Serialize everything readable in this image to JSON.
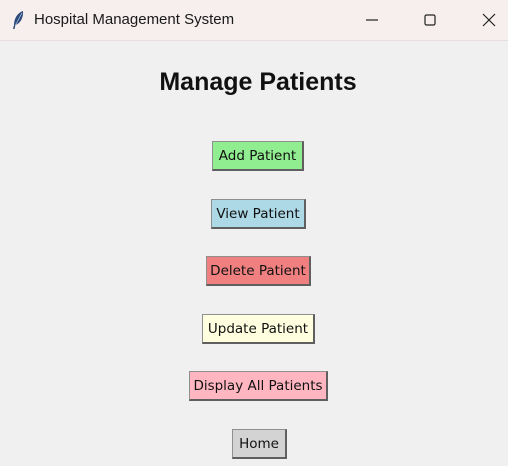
{
  "window": {
    "title": "Hospital Management System"
  },
  "page": {
    "heading": "Manage Patients"
  },
  "buttons": {
    "add": {
      "label": "Add Patient",
      "color": "#90ee90"
    },
    "view": {
      "label": "View Patient",
      "color": "#add8e6"
    },
    "delete": {
      "label": "Delete Patient",
      "color": "#f08080"
    },
    "update": {
      "label": "Update Patient",
      "color": "#ffffe0"
    },
    "display_all": {
      "label": "Display All Patients",
      "color": "#ffb6c1"
    },
    "home": {
      "label": "Home",
      "color": "#d3d3d3"
    }
  },
  "icons": {
    "app": "feather-icon",
    "minimize": "minimize-icon",
    "maximize": "maximize-icon",
    "close": "close-icon"
  }
}
